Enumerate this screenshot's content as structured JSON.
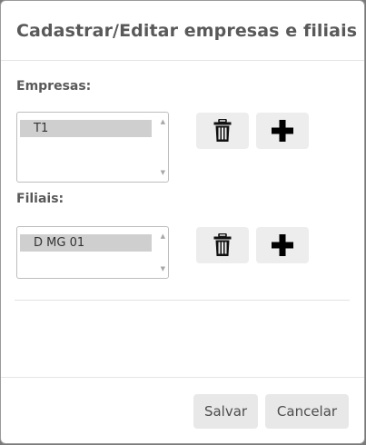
{
  "modal": {
    "title": "Cadastrar/Editar empresas e filiais"
  },
  "empresas": {
    "label": "Empresas:",
    "items": [
      "T1"
    ],
    "delete_icon": "trash-icon",
    "add_icon": "plus-icon"
  },
  "filiais": {
    "label": "Filiais:",
    "items": [
      "D MG 01"
    ],
    "delete_icon": "trash-icon",
    "add_icon": "plus-icon"
  },
  "footer": {
    "save_label": "Salvar",
    "cancel_label": "Cancelar"
  }
}
